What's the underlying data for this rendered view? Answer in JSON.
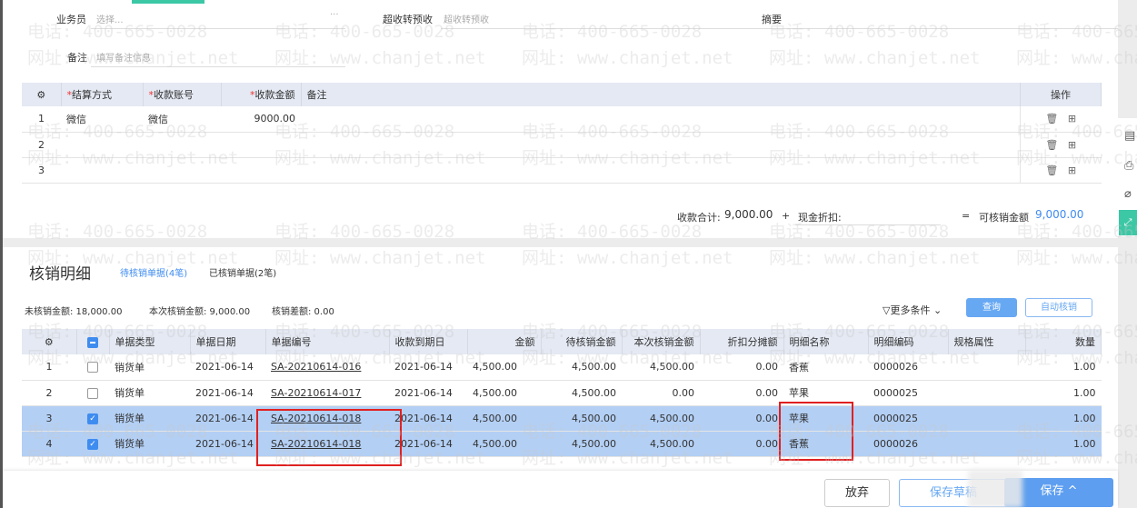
{
  "form": {
    "salesman_label": "业务员",
    "salesman_placeholder": "选择...",
    "more": "···",
    "overflow_label": "超收转预收",
    "overflow_placeholder": "超收转预收",
    "summary_label": "摘要",
    "note_label": "备注",
    "note_placeholder": "填写备注信息"
  },
  "pay_table": {
    "headers": [
      "结算方式",
      "收款账号",
      "收款金额",
      "备注",
      "操作"
    ],
    "rows": [
      {
        "no": "1",
        "method": "微信",
        "account": "微信",
        "amount": "9000.00",
        "note": ""
      },
      {
        "no": "2",
        "method": "",
        "account": "",
        "amount": "",
        "note": ""
      },
      {
        "no": "3",
        "method": "",
        "account": "",
        "amount": "",
        "note": ""
      }
    ]
  },
  "totals": {
    "receipt_label": "收款合计:",
    "receipt_value": "9,000.00",
    "plus": "+",
    "discount_label": "现金折扣:",
    "eq": "=",
    "writeoff_label": "可核销金额",
    "writeoff_value": "9,000.00"
  },
  "detail": {
    "title": "核销明细",
    "tab_pending": "待核销单据(4笔)",
    "tab_done": "已核销单据(2笔)",
    "unwritten": "未核销金额: 18,000.00",
    "current": "本次核销金额: 9,000.00",
    "diff": "核销差额: 0.00",
    "more_filter": "更多条件",
    "query": "查询",
    "auto": "自动核销",
    "headers": [
      "单据类型",
      "单据日期",
      "单据编号",
      "收款到期日",
      "金额",
      "待核销金额",
      "本次核销金额",
      "折扣分摊额",
      "明细名称",
      "明细编码",
      "规格属性",
      "数量"
    ],
    "rows": [
      {
        "no": "1",
        "checked": false,
        "type": "销货单",
        "date": "2021-06-14",
        "code": "SA-20210614-016",
        "due": "2021-06-14",
        "amount": "4,500.00",
        "pending": "4,500.00",
        "current": "4,500.00",
        "discount": "0.00",
        "name": "香蕉",
        "itemcode": "0000026",
        "spec": "",
        "qty": "1.00"
      },
      {
        "no": "2",
        "checked": false,
        "type": "销货单",
        "date": "2021-06-14",
        "code": "SA-20210614-017",
        "due": "2021-06-14",
        "amount": "4,500.00",
        "pending": "4,500.00",
        "current": "0.00",
        "discount": "0.00",
        "name": "苹果",
        "itemcode": "0000025",
        "spec": "",
        "qty": "1.00"
      },
      {
        "no": "3",
        "checked": true,
        "type": "销货单",
        "date": "2021-06-14",
        "code": "SA-20210614-018",
        "due": "2021-06-14",
        "amount": "4,500.00",
        "pending": "4,500.00",
        "current": "4,500.00",
        "discount": "0.00",
        "name": "苹果",
        "itemcode": "0000025",
        "spec": "",
        "qty": "1.00"
      },
      {
        "no": "4",
        "checked": true,
        "type": "销货单",
        "date": "2021-06-14",
        "code": "SA-20210614-018",
        "due": "2021-06-14",
        "amount": "4,500.00",
        "pending": "4,500.00",
        "current": "4,500.00",
        "discount": "0.00",
        "name": "香蕉",
        "itemcode": "0000026",
        "spec": "",
        "qty": "1.00"
      }
    ]
  },
  "footer": {
    "discard": "放弃",
    "draft": "保存草稿",
    "save": "保存 ^"
  },
  "watermark": {
    "phone": "电话: 400-665-0028",
    "site": "网址: www.chanjet.net"
  },
  "colors": {
    "accent": "#3f8cf0",
    "tab": "#3cc7a5",
    "selected": "#b3cff4",
    "highlight": "#e02020"
  }
}
